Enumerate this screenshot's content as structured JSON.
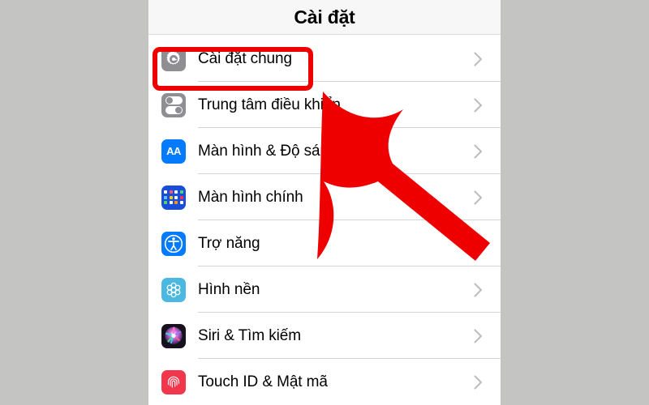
{
  "window": {
    "background_color": "#c4c4c3",
    "screen_background": "#ffffff"
  },
  "nav": {
    "title": "Cài đặt"
  },
  "settings": {
    "rows": [
      {
        "label": "Cài đặt chung",
        "icon": "gear-icon",
        "icon_color": "#8e8e93",
        "chevron": "chevron-right-icon",
        "highlighted": true
      },
      {
        "label": "Trung tâm điều khiển",
        "icon": "control-center-toggles-icon",
        "icon_color": "#8e8e93",
        "chevron": "chevron-right-icon",
        "highlighted": false
      },
      {
        "label": "Màn hình & Độ sáng",
        "icon": "display-brightness-aa-icon",
        "icon_color": "#047aff",
        "chevron": "chevron-right-icon",
        "highlighted": false
      },
      {
        "label": "Màn hình chính",
        "icon": "home-screen-grid-icon",
        "icon_color": "#1b4ddb",
        "chevron": "chevron-right-icon",
        "highlighted": false
      },
      {
        "label": "Trợ năng",
        "icon": "accessibility-icon",
        "icon_color": "#047aff",
        "chevron": "chevron-right-icon",
        "highlighted": false
      },
      {
        "label": "Hình nền",
        "icon": "wallpaper-flower-icon",
        "icon_color": "#4ab8e0",
        "chevron": "chevron-right-icon",
        "highlighted": false
      },
      {
        "label": "Siri & Tìm kiếm",
        "icon": "siri-orb-icon",
        "icon_color": "#15121d",
        "chevron": "chevron-right-icon",
        "highlighted": false
      },
      {
        "label": "Touch ID & Mật mã",
        "icon": "fingerprint-icon",
        "icon_color": "#f2374c",
        "chevron": "chevron-right-icon",
        "highlighted": false
      }
    ]
  },
  "annotations": {
    "highlight_color": "#ee0000",
    "arrow_color": "#ee0000",
    "highlight_target": "Cài đặt chung",
    "arrow_points_to": "Cài đặt chung"
  },
  "icon_palettes": {
    "home_screen_dots": [
      "#ffffff",
      "#ff5b5b",
      "#ffffff",
      "#4cd964",
      "#5ac8fa",
      "#ffcc00",
      "#ffffff",
      "#ff2d55",
      "#4cd964",
      "#ffffff",
      "#ff9500",
      "#ffffff"
    ]
  }
}
